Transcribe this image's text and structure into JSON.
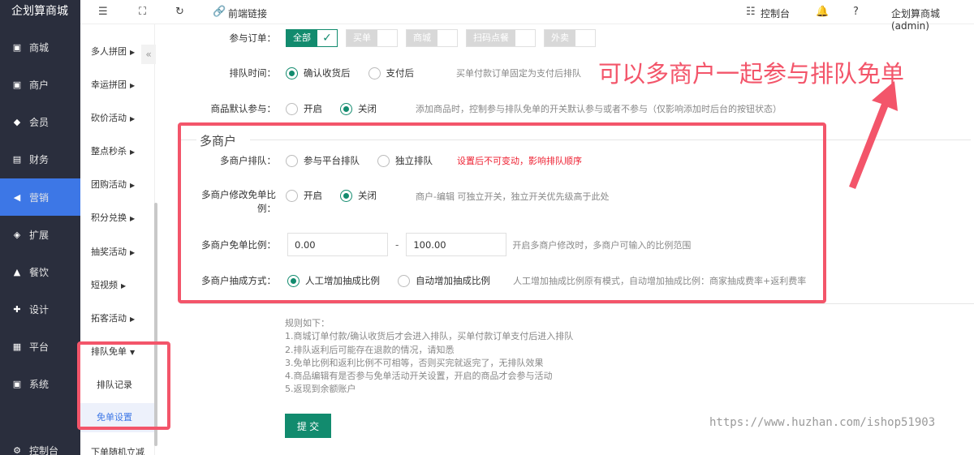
{
  "app": {
    "brand": "企划算商城"
  },
  "sidebar": {
    "items": [
      {
        "label": "商城",
        "icon": "store-icon"
      },
      {
        "label": "商户",
        "icon": "merchant-icon"
      },
      {
        "label": "会员",
        "icon": "member-icon"
      },
      {
        "label": "财务",
        "icon": "finance-icon"
      },
      {
        "label": "营销",
        "icon": "megaphone-icon"
      },
      {
        "label": "扩展",
        "icon": "extension-icon"
      },
      {
        "label": "餐饮",
        "icon": "dining-icon"
      },
      {
        "label": "设计",
        "icon": "design-icon"
      },
      {
        "label": "平台",
        "icon": "platform-icon"
      },
      {
        "label": "系统",
        "icon": "system-icon"
      },
      {
        "label": "控制台",
        "icon": "console-icon"
      }
    ],
    "active": "营销"
  },
  "subnav": {
    "items": [
      "多人拼团",
      "幸运拼团",
      "砍价活动",
      "整点秒杀",
      "团购活动",
      "积分兑换",
      "抽奖活动",
      "短视频",
      "拓客活动",
      "排队免单",
      "下单随机立减"
    ],
    "children": [
      "排队记录",
      "免单设置"
    ],
    "active_child": "免单设置",
    "collapse_glyph": "«"
  },
  "topbar": {
    "frontend_link": "前端链接",
    "console": "控制台",
    "user": "企划算商城(admin)"
  },
  "form": {
    "order_join": {
      "label": "参与订单：",
      "options": [
        {
          "label": "全部",
          "on": true
        },
        {
          "label": "买单",
          "on": false
        },
        {
          "label": "商城",
          "on": false
        },
        {
          "label": "扫码点餐",
          "on": false
        },
        {
          "label": "外卖",
          "on": false
        }
      ]
    },
    "queue_time": {
      "label": "排队时间：",
      "options": [
        "确认收货后",
        "支付后"
      ],
      "hint": "买单付款订单固定为支付后排队"
    },
    "default_join": {
      "label": "商品默认参与：",
      "options": [
        "开启",
        "关闭"
      ],
      "hint": "添加商品时，控制参与排队免单的开关默认参与或者不参与（仅影响添加时后台的按钮状态）"
    },
    "multi_merchant": {
      "title": "多商户",
      "queue": {
        "label": "多商户排队：",
        "options": [
          "参与平台排队",
          "独立排队"
        ],
        "warn": "设置后不可变动，影响排队顺序"
      },
      "modify_ratio": {
        "label_line1": "多商户修改免单比",
        "label_line2": "例：",
        "options": [
          "开启",
          "关闭"
        ],
        "hint": "商户-编辑 可独立开关，独立开关优先级高于此处"
      },
      "ratio": {
        "label": "多商户免单比例：",
        "min": "0.00",
        "dash": "-",
        "max": "100.00",
        "hint": "开启多商户修改时，多商户可输入的比例范围"
      },
      "commission": {
        "label": "多商户抽成方式：",
        "options": [
          "人工增加抽成比例",
          "自动增加抽成比例"
        ],
        "hint": "人工增加抽成比例原有模式，自动增加抽成比例：商家抽成费率+返利费率"
      }
    },
    "rules": {
      "title": "规则如下：",
      "lines": [
        "1.商城订单付款/确认收货后才会进入排队，买单付款订单支付后进入排队",
        "2.排队返利后可能存在退款的情况，请知悉",
        "3.免单比例和返利比例不可相等，否则买完就返完了，无排队效果",
        "4.商品编辑有是否参与免单活动开关设置，开启的商品才会参与活动",
        "5.返现到余额账户"
      ]
    },
    "submit": "提 交"
  },
  "annotation": "可以多商户一起参与排队免单",
  "watermark": "https://www.huzhan.com/ishop51903",
  "colors": {
    "sidebar_bg": "#2a2e3d",
    "active": "#3d77e6",
    "primary": "#128b6e",
    "annotation": "#f3556a"
  }
}
